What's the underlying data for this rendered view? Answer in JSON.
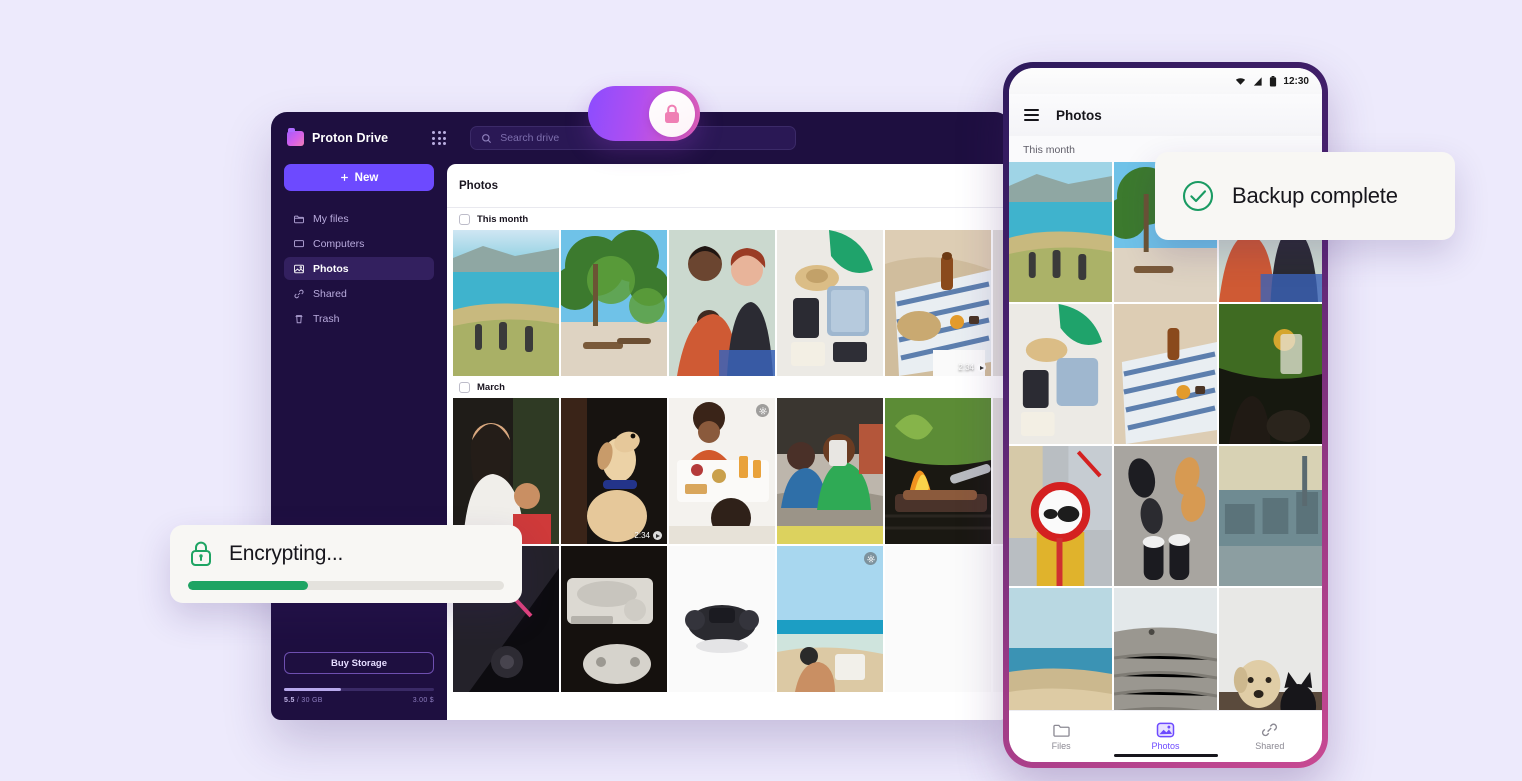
{
  "theme": {
    "page_background": "#edeafc",
    "brand_purple": "#6d4aff",
    "accent_pink": "#e05fb6",
    "success_green": "#1ea463",
    "window_dark": "#1e0f40"
  },
  "desktop": {
    "brand": {
      "name": "Proton Drive",
      "icon": "folder-icon"
    },
    "apps_icon": "apps-grid-icon",
    "search": {
      "icon": "search-icon",
      "placeholder": "Search drive",
      "value": ""
    },
    "new_button": {
      "label": "New",
      "icon": "plus-icon"
    },
    "nav_items": [
      {
        "label": "My files",
        "icon": "folder-icon",
        "active": false
      },
      {
        "label": "Computers",
        "icon": "monitor-icon",
        "active": false
      },
      {
        "label": "Photos",
        "icon": "image-icon",
        "active": true
      },
      {
        "label": "Shared",
        "icon": "link-icon",
        "active": false
      },
      {
        "label": "Trash",
        "icon": "trash-icon",
        "active": false
      }
    ],
    "storage": {
      "buy_label": "Buy Storage",
      "used_label": "5.5",
      "total_label": "/ 30 GB",
      "right_label": "3.00 $",
      "percent": 38
    },
    "content": {
      "title": "Photos",
      "groups": [
        {
          "label": "This month",
          "checked": false
        },
        {
          "label": "March",
          "checked": false
        }
      ],
      "video_duration": "2:34"
    }
  },
  "phone": {
    "status_bar": {
      "time": "12:30",
      "icons": [
        "wifi-icon",
        "signal-icon",
        "battery-icon"
      ]
    },
    "menu_icon": "hamburger-menu-icon",
    "title": "Photos",
    "section_label": "This month",
    "tabs": [
      {
        "label": "Files",
        "icon": "folder-icon",
        "active": false
      },
      {
        "label": "Photos",
        "icon": "image-icon",
        "active": true
      },
      {
        "label": "Shared",
        "icon": "link-icon",
        "active": false
      }
    ]
  },
  "badges": {
    "toggle": {
      "icon": "lock-icon",
      "state": "on"
    },
    "encrypting": {
      "icon": "lock-icon",
      "label": "Encrypting...",
      "percent": 38
    },
    "backup": {
      "icon": "check-circle-icon",
      "label": "Backup complete"
    }
  }
}
